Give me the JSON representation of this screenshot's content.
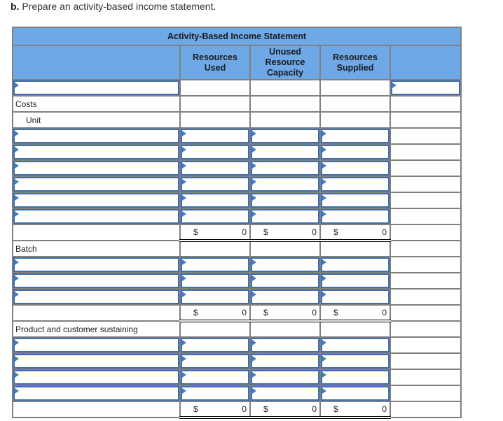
{
  "instruction": {
    "part": "b.",
    "text": "Prepare an activity-based income statement."
  },
  "table": {
    "title": "Activity-Based Income Statement",
    "columns": [
      "",
      "Resources Used",
      "Unused Resource Capacity",
      "Resources Supplied",
      ""
    ],
    "column_lines": {
      "used": [
        "Resources",
        "Used"
      ],
      "unused": [
        "Unused",
        "Resource",
        "Capacity"
      ],
      "supplied": [
        "Resources",
        "Supplied"
      ]
    },
    "top_row": {
      "label_value": "",
      "right_value": ""
    },
    "sections": {
      "costs_label": "Costs",
      "unit": {
        "label": "Unit",
        "rows": 6,
        "total": {
          "currency": "$",
          "used": "0",
          "unused": "0",
          "supplied": "0"
        }
      },
      "batch": {
        "label": "Batch",
        "rows": 3,
        "total": {
          "currency": "$",
          "used": "0",
          "unused": "0",
          "supplied": "0"
        }
      },
      "product": {
        "label": "Product and customer sustaining",
        "rows": 4,
        "total": {
          "currency": "$",
          "used": "0",
          "unused": "0",
          "supplied": "0"
        }
      }
    },
    "icons": {
      "input_marker": "dropdown-flag-icon"
    },
    "colors": {
      "header_bg": "#6fa8e6",
      "input_border": "#3f6fae",
      "marker": "#3b7fd4"
    }
  }
}
